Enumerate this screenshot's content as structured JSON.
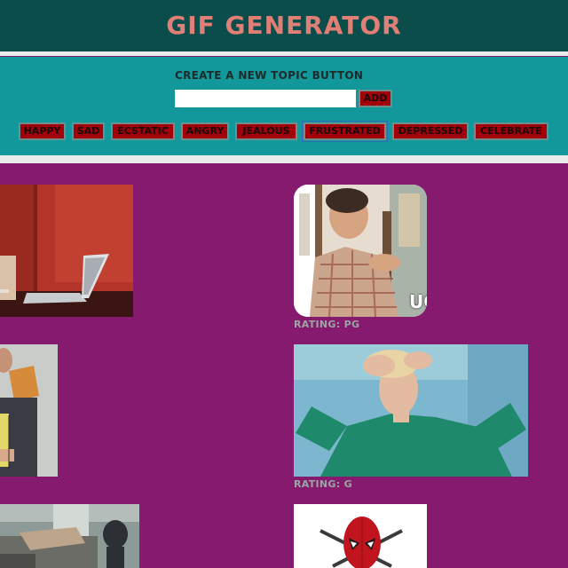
{
  "header": {
    "title": "GIF GENERATOR"
  },
  "form": {
    "label": "CREATE A NEW TOPIC BUTTON",
    "input_value": "",
    "add_label": "ADD"
  },
  "topics": [
    {
      "label": "HAPPY"
    },
    {
      "label": "SAD"
    },
    {
      "label": "ECSTATIC"
    },
    {
      "label": "ANGRY"
    },
    {
      "label": "JEALOUS"
    },
    {
      "label": "FRUSTRATED",
      "active": true
    },
    {
      "label": "DEPRESSED"
    },
    {
      "label": "CELEBRATE"
    }
  ],
  "gifs": [
    {
      "caption_overlay": "",
      "rating": ""
    },
    {
      "caption_overlay": "UG",
      "rating": "RATING: PG"
    },
    {
      "caption_overlay": "",
      "rating": ""
    },
    {
      "caption_overlay": "",
      "rating": "RATING: G"
    },
    {
      "caption_overlay": "",
      "rating": ""
    },
    {
      "caption_overlay": "",
      "rating": ""
    }
  ]
}
